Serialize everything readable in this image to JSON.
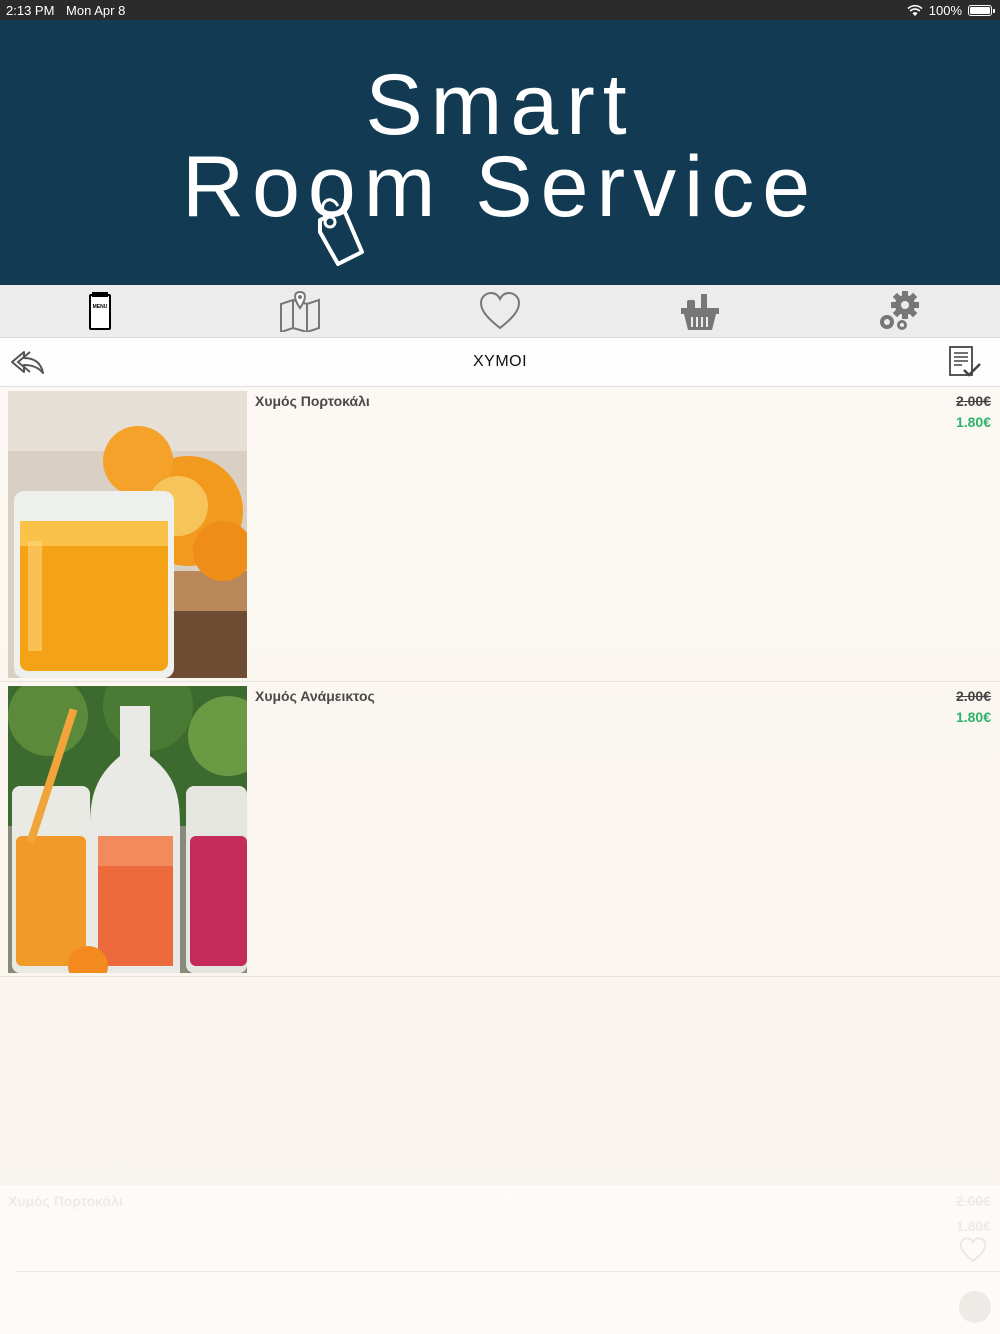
{
  "status": {
    "time": "2:13 PM",
    "date": "Mon Apr 8",
    "battery": "100%",
    "battery_level": 1.0
  },
  "brand": {
    "line1": "Smart",
    "line2": "Room Service",
    "banner_color": "#123a52"
  },
  "nav": {
    "items": [
      {
        "icon": "menu-icon",
        "menu_label": "MENU"
      },
      {
        "icon": "map-icon"
      },
      {
        "icon": "heart-icon"
      },
      {
        "icon": "basket-icon"
      },
      {
        "icon": "settings-gears-icon"
      }
    ]
  },
  "titlebar": {
    "title": "ΧΥΜΟΙ",
    "back_icon": "back-arrow-icon",
    "order_icon": "checklist-icon"
  },
  "products": [
    {
      "name": "Χυμός Πορτοκάλι",
      "old_price": "2.00€",
      "price": "1.80€",
      "image": "orange-juice-photo"
    },
    {
      "name": "Χυμός Ανάμεικτος",
      "old_price": "2.00€",
      "price": "1.80€",
      "image": "mixed-juices-photo"
    }
  ],
  "ghost_item": {
    "name": "Χυμός Πορτοκάλι",
    "old_price": "2.00€",
    "price": "1.80€"
  },
  "colors": {
    "price_green": "#2db36a",
    "nav_bg": "#ececec"
  }
}
